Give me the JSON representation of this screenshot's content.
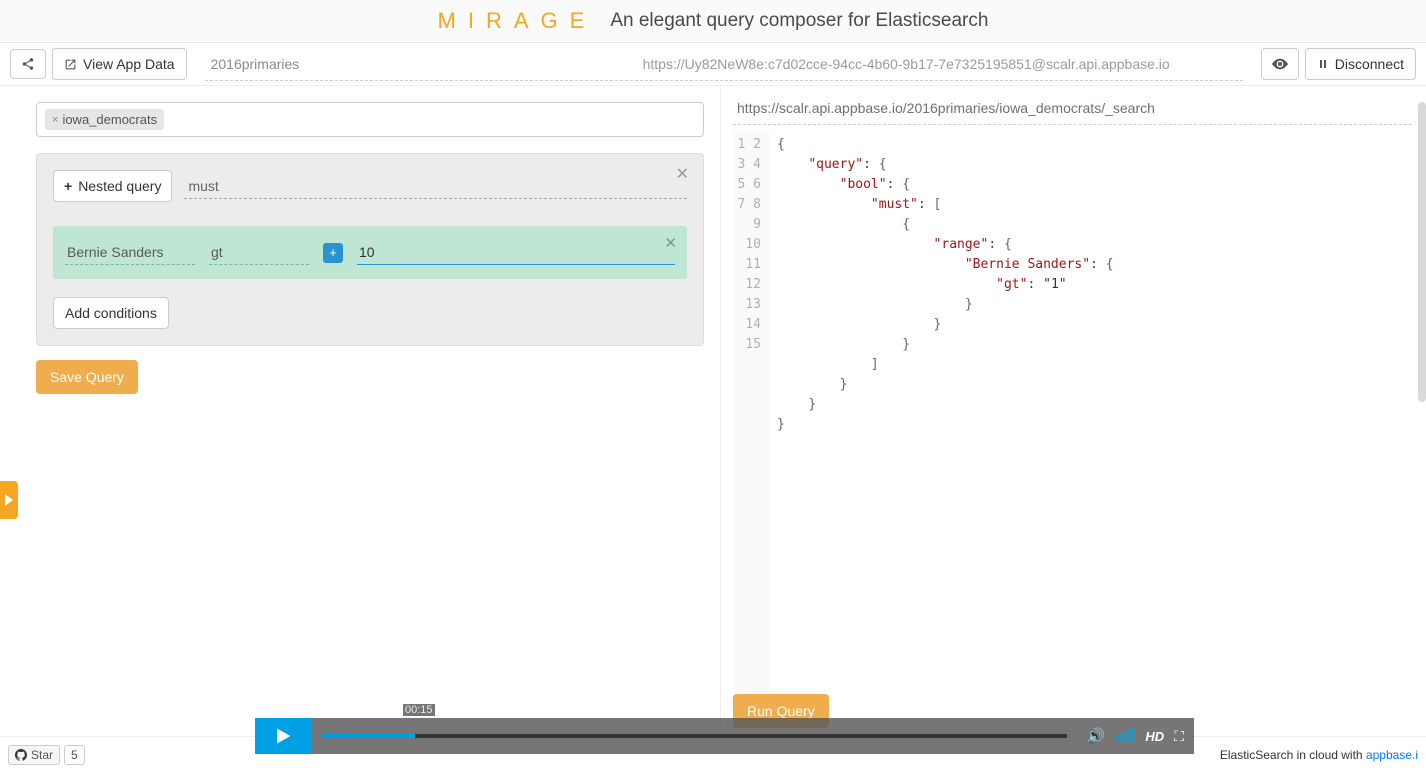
{
  "header": {
    "brand": "MIRAGE",
    "tagline": "An elegant query composer for Elasticsearch"
  },
  "toolbar": {
    "share_icon": "share",
    "view_app_data": "View App Data",
    "index_name": "2016primaries",
    "connection_url": "https://Uy82NeW8e:c7d02cce-94cc-4b60-9b17-7e7325195851@scalr.api.appbase.io",
    "eye_icon": "eye",
    "disconnect": "Disconnect"
  },
  "builder": {
    "type_tag": "iowa_democrats",
    "nested_query_btn": "Nested query",
    "bool_clause": "must",
    "condition": {
      "field": "Bernie Sanders",
      "operator": "gt",
      "value": "10"
    },
    "add_conditions": "Add conditions",
    "save_query": "Save Query"
  },
  "result": {
    "endpoint": "https://scalr.api.appbase.io/2016primaries/iowa_democrats/_search",
    "json_lines": [
      "{",
      "    \"query\": {",
      "        \"bool\": {",
      "            \"must\": [",
      "                {",
      "                    \"range\": {",
      "                        \"Bernie Sanders\": {",
      "                            \"gt\": \"1\"",
      "                        }",
      "                    }",
      "                }",
      "            ]",
      "        }",
      "    }",
      "}"
    ],
    "run_query": "Run Query"
  },
  "footer": {
    "star": "Star",
    "star_count": "5",
    "promo_prefix": "ElasticSearch in cloud with ",
    "promo_link": "appbase.i"
  },
  "video": {
    "time": "00:15",
    "hd": "HD"
  }
}
